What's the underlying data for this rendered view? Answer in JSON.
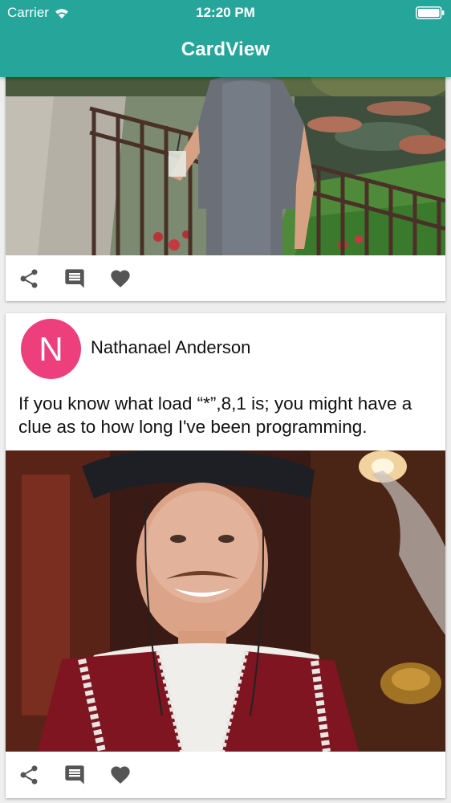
{
  "status_bar": {
    "carrier": "Carrier",
    "time": "12:20 PM"
  },
  "app_bar": {
    "title": "CardView"
  },
  "cards": [
    {
      "photo_icon": "photo-person-at-park-railing",
      "actions": [
        "share-icon",
        "comment-icon",
        "heart-icon"
      ]
    },
    {
      "author": {
        "initial": "N",
        "name": "Nathanael Anderson",
        "avatar_color": "#ed3f7c"
      },
      "text": "If you know what load “*”,8,1 is; you might have a clue as to how long I've been programming.",
      "photo_icon": "photo-man-in-pirate-costume",
      "actions": [
        "share-icon",
        "comment-icon",
        "heart-icon"
      ]
    }
  ],
  "colors": {
    "primary": "#26a69a",
    "icon": "#555555",
    "background": "#eeeeee"
  }
}
